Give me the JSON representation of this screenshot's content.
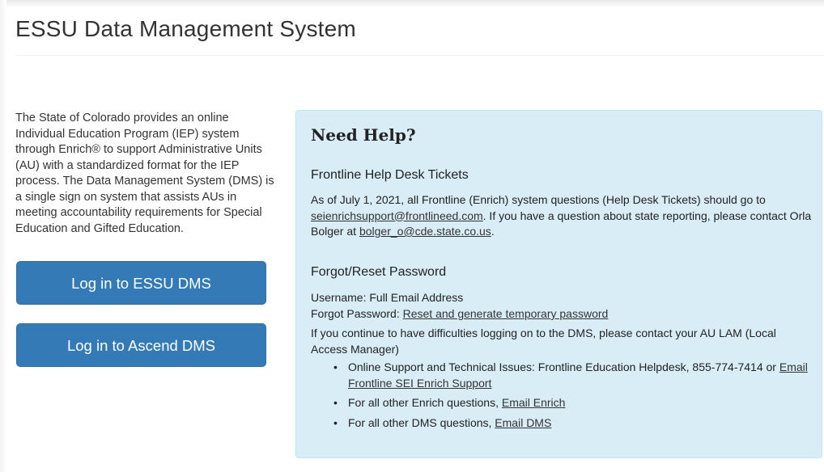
{
  "header": {
    "title": "ESSU Data Management System"
  },
  "intro": {
    "text": "The State of Colorado provides an online Individual Education Program (IEP) system through Enrich® to support Administrative Units (AU) with a standardized format for the IEP process. The Data Management System (DMS) is a single sign on system that assists AUs in meeting accountability requirements for Special Education and Gifted Education."
  },
  "buttons": {
    "essu_label": "Log in to ESSU DMS",
    "ascend_label": "Log in to Ascend DMS"
  },
  "help": {
    "title": "Need Help?",
    "tickets": {
      "title": "Frontline Help Desk Tickets",
      "text1": "As of July 1, 2021, all Frontline (Enrich) system questions (Help Desk Tickets) should go to",
      "email1": "seienrichsupport@frontlineed.com",
      "text2": ". If you have a question about state reporting, please contact Orla Bolger at ",
      "email2": "bolger_o@cde.state.co.us",
      "text3": "."
    },
    "password": {
      "title": "Forgot/Reset Password",
      "username": "Username: Full Email Address",
      "forgot_prefix": "Forgot Password: ",
      "forgot_link": "Reset and generate temporary password",
      "continue_text": "If you continue to have difficulties logging on to the DMS, please contact your AU LAM (Local Access Manager)"
    },
    "list": [
      {
        "text": "Online Support and Technical Issues: Frontline Education Helpdesk, 855-774-7414 or ",
        "link": "Email Frontline SEI Enrich Support"
      },
      {
        "text": "For all other Enrich questions, ",
        "link": "Email Enrich"
      },
      {
        "text": "For all other DMS questions, ",
        "link": "Email DMS"
      }
    ]
  }
}
